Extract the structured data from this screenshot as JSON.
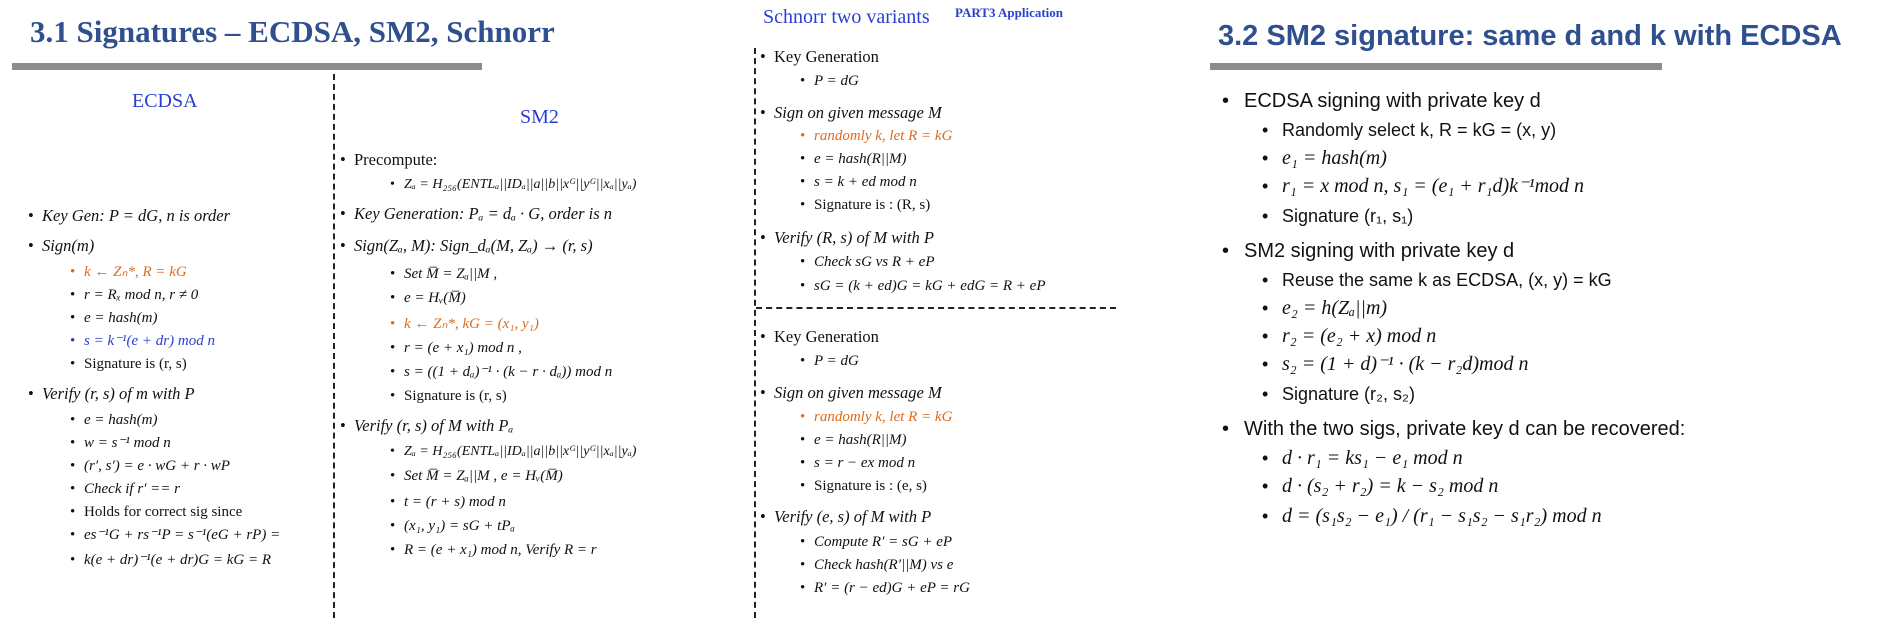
{
  "left_title": "3.1  Signatures – ECDSA, SM2, Schnorr",
  "right_title": "3.2  SM2 signature: same d and k with ECDSA",
  "schnorr_title": "Schnorr two variants",
  "part_label": "PART3  Application",
  "ecdsa": {
    "header": "ECDSA",
    "keygen": "Key Gen: P = dG, n is order",
    "sign": "Sign(m)",
    "sign_items": [
      "k ← Zₙ*, R = kG",
      "r = Rₓ mod n, r ≠ 0",
      "e = hash(m)",
      "s = k⁻¹(e + dr) mod n",
      "Signature is (r, s)"
    ],
    "verify": "Verify (r, s) of m with P",
    "verify_items": [
      "e = hash(m)",
      "w = s⁻¹ mod n",
      "(r′, s′) = e · wG + r · wP",
      "Check if r′ == r",
      "Holds for correct sig since",
      "es⁻¹G + rs⁻¹P = s⁻¹(eG + rP) =",
      "k(e + dr)⁻¹(e + dr)G = kG = R"
    ]
  },
  "sm2": {
    "header": "SM2",
    "precompute": "Precompute:",
    "precompute_item": "Zₐ = H₂₅₆(ENTLₐ||IDₐ||a||b||xᴳ||yᴳ||xₐ||yₐ)",
    "keygen": "Key Generation:  Pₐ = dₐ · G,  order is n",
    "sign": "Sign(Zₐ, M): Sign_dₐ(M, Zₐ) → (r, s)",
    "sign_items": [
      "Set M̅ = Zₐ||M ,",
      "e = Hᵥ(M̅)",
      "k ← Zₙ*,  kG = (x₁, y₁)",
      "r = (e + x₁) mod n ,",
      "s = ((1 + dₐ)⁻¹ · (k − r · dₐ)) mod n",
      "Signature is (r, s)"
    ],
    "verify": "Verify (r, s) of M with Pₐ",
    "verify_items": [
      "Zₐ = H₂₅₆(ENTLₐ||IDₐ||a||b||xᴳ||yᴳ||xₐ||yₐ)",
      "Set M̅ = Zₐ||M ,   e = Hᵥ(M̅)",
      "t = (r + s) mod n",
      "(x₁, y₁) = sG + tPₐ",
      "R = (e + x₁) mod n,  Verify R = r"
    ]
  },
  "schnorr1": {
    "keygen": "Key Generation",
    "keygen_item": "P = dG",
    "sign": "Sign on given message M",
    "sign_items": [
      "randomly k, let R = kG",
      "e = hash(R||M)",
      "s = k + ed mod n",
      "Signature is : (R, s)"
    ],
    "verify": "Verify (R, s) of M with P",
    "verify_items": [
      "Check sG vs R + eP",
      "sG = (k + ed)G = kG + edG = R + eP"
    ]
  },
  "schnorr2": {
    "keygen": "Key Generation",
    "keygen_item": "P = dG",
    "sign": "Sign on given message M",
    "sign_items": [
      "randomly k, let R = kG",
      "e = hash(R||M)",
      "s = r − ex mod n",
      "Signature is : (e, s)"
    ],
    "verify": "Verify (e, s) of M with P",
    "verify_items": [
      "Compute R′ = sG + eP",
      "Check hash(R′||M) vs e",
      "R′ = (r − ed)G + eP = rG"
    ]
  },
  "recovery": {
    "ecdsa": "ECDSA signing with private key d",
    "ecdsa_items": [
      "Randomly select k, R = kG = (x, y)",
      "e₁ = hash(m)",
      "r₁ = x mod n, s₁ = (e₁ + r₁d)k⁻¹mod n",
      "Signature (r₁, s₁)"
    ],
    "sm2": "SM2 signing with private key d",
    "sm2_items": [
      "Reuse the same k as ECDSA, (x, y) = kG",
      "e₂ = h(Zₐ||m)",
      "r₂ = (e₂ + x) mod n",
      "s₂ = (1 + d)⁻¹ · (k − r₂d)mod n",
      "Signature (r₂, s₂)"
    ],
    "both": "With the two sigs, private key d can be recovered:",
    "both_items": [
      "d · r₁ = ks₁ − e₁ mod n",
      "d · (s₂ + r₂) = k − s₂ mod n",
      "d = (s₁s₂ − e₁) / (r₁ − s₁s₂ − s₁r₂) mod n"
    ]
  },
  "colors": {
    "title": "#2f4f8f",
    "accent_blue": "#2a3fcf",
    "accent_orange": "#e06a1b",
    "bar": "#8c8c8c"
  }
}
